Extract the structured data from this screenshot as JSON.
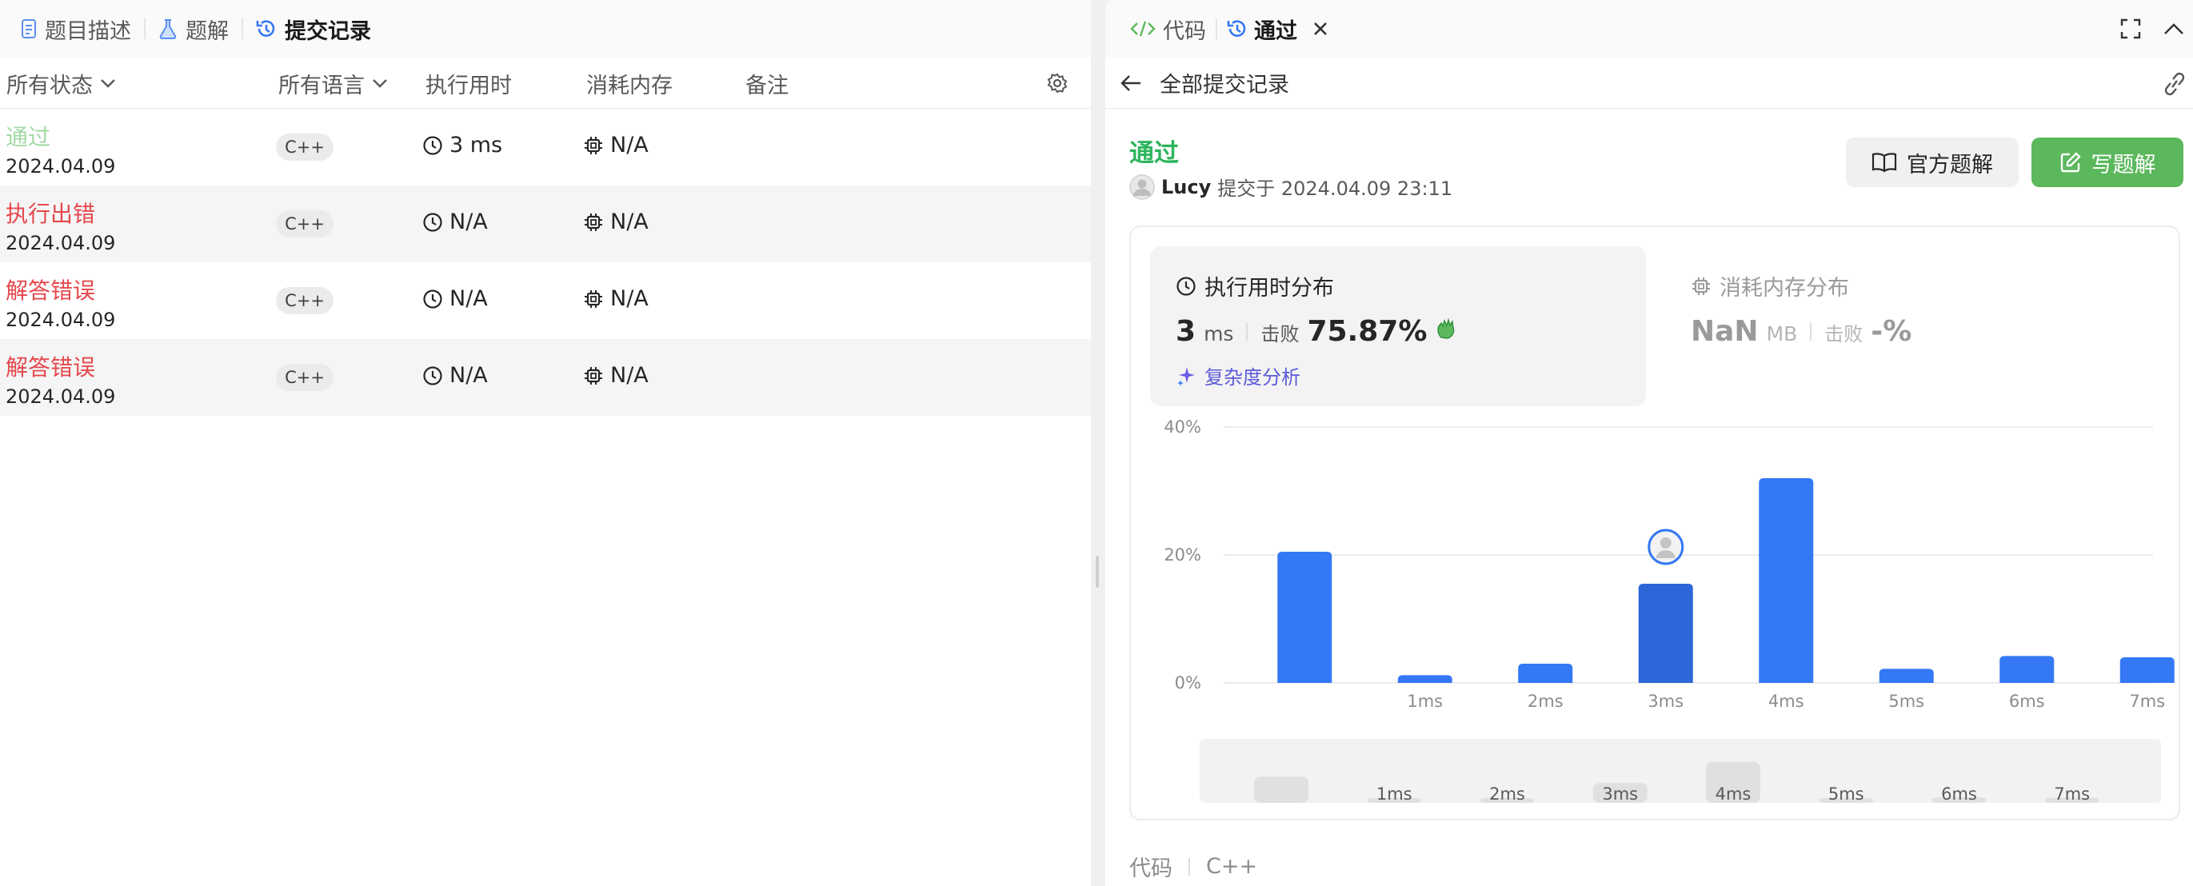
{
  "left": {
    "tabs": [
      {
        "label": "题目描述",
        "icon": "document-icon"
      },
      {
        "label": "题解",
        "icon": "flask-icon"
      },
      {
        "label": "提交记录",
        "icon": "history-icon"
      }
    ],
    "filters": {
      "status": "所有状态",
      "language": "所有语言",
      "runtime": "执行用时",
      "memory": "消耗内存",
      "notes": "备注"
    },
    "submissions": [
      {
        "status": "通过",
        "status_color": "#a3d9a5",
        "date": "2024.04.09",
        "language": "C++",
        "runtime": "3 ms",
        "memory": "N/A"
      },
      {
        "status": "执行出错",
        "status_color": "#e5484d",
        "date": "2024.04.09",
        "language": "C++",
        "runtime": "N/A",
        "memory": "N/A"
      },
      {
        "status": "解答错误",
        "status_color": "#e5484d",
        "date": "2024.04.09",
        "language": "C++",
        "runtime": "N/A",
        "memory": "N/A"
      },
      {
        "status": "解答错误",
        "status_color": "#e5484d",
        "date": "2024.04.09",
        "language": "C++",
        "runtime": "N/A",
        "memory": "N/A"
      }
    ]
  },
  "right": {
    "tabs": {
      "code": "代码",
      "result": "通过"
    },
    "back_label": "全部提交记录",
    "result_title": "通过",
    "user": "Lucy",
    "submitted_label": "提交于 2024.04.09 23:11",
    "official_button": "官方题解",
    "write_button": "写题解",
    "runtime_title": "执行用时分布",
    "runtime_value": "3",
    "runtime_unit": "ms",
    "beat_label": "击败",
    "runtime_percent": "75.87%",
    "analysis_label": "复杂度分析",
    "memory_title": "消耗内存分布",
    "memory_value": "NaN",
    "memory_unit": "MB",
    "memory_beat_label": "击败",
    "memory_percent": "-%",
    "code_label": "代码",
    "code_language": "C++"
  },
  "colors": {
    "accepted": "#2db55d",
    "error": "#e5484d",
    "bar": "#3478f6",
    "bar_highlight": "#2c66d8",
    "write_button": "#5cb85c"
  },
  "chart_data": {
    "type": "bar",
    "categories": [
      "",
      "1ms",
      "2ms",
      "3ms",
      "4ms",
      "5ms",
      "6ms",
      "7ms"
    ],
    "values": [
      20.5,
      1.2,
      3.0,
      15.5,
      32.0,
      2.2,
      4.2,
      4.0
    ],
    "highlight_index": 3,
    "ylim": [
      0,
      40
    ],
    "yticks": [
      "0%",
      "20%",
      "40%"
    ],
    "grid": true
  }
}
